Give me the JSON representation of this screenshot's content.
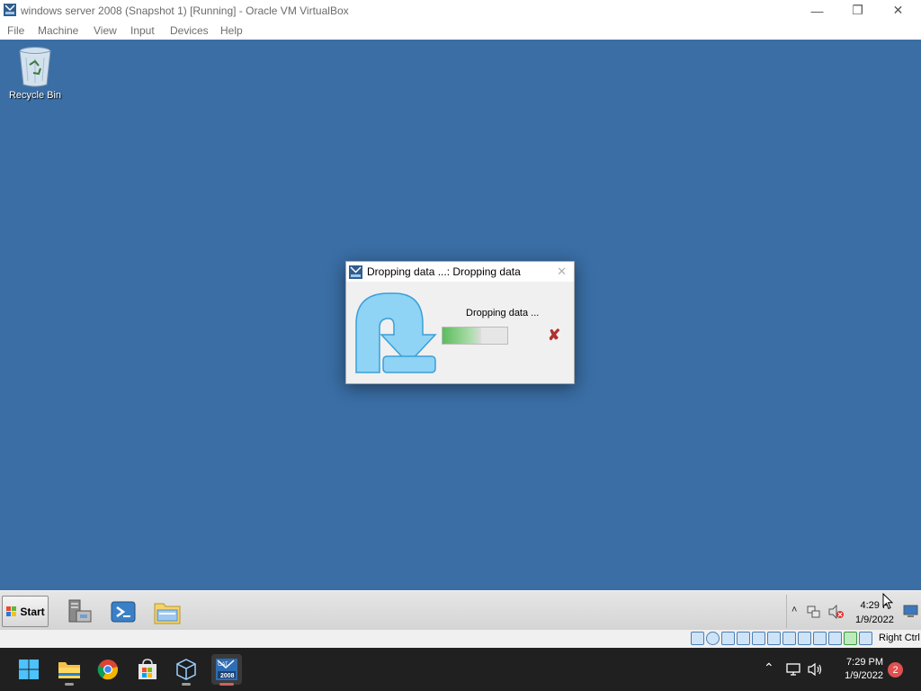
{
  "window": {
    "title": "windows server 2008 (Snapshot 1) [Running] - Oracle VM VirtualBox",
    "minimize": "—",
    "maximize": "❐",
    "close": "✕"
  },
  "menubar": {
    "items": [
      "File",
      "Machine",
      "View",
      "Input",
      "Devices",
      "Help"
    ]
  },
  "desktop": {
    "background_color": "#3a6ea5",
    "icons": [
      {
        "label": "Recycle Bin",
        "icon": "recycle-bin-icon"
      }
    ]
  },
  "dialog": {
    "title": "Dropping data ...: Dropping data",
    "status": "Dropping data ...",
    "close": "✕",
    "cancel": "✘",
    "progress": 0.6
  },
  "guest_taskbar": {
    "start_label": "Start",
    "pinned": [
      "server-manager-icon",
      "powershell-icon",
      "windows-explorer-icon"
    ],
    "clock": {
      "time": "4:29 P",
      "date": "1/9/2022"
    }
  },
  "statusbar": {
    "host_key": "Right Ctrl"
  },
  "host_taskbar": {
    "apps": [
      "windows-start-icon",
      "file-explorer-icon",
      "chrome-icon",
      "microsoft-store-icon",
      "virtualbox-icon",
      "windows-server-2008-vm-icon"
    ],
    "vm_badge_top": "CAT",
    "vm_badge_bottom": "2008",
    "clock": {
      "time": "7:29 PM",
      "date": "1/9/2022"
    },
    "notification_count": "2"
  },
  "colors": {
    "accent_host": "#d06060",
    "progress_green": "#5dbb5d"
  }
}
